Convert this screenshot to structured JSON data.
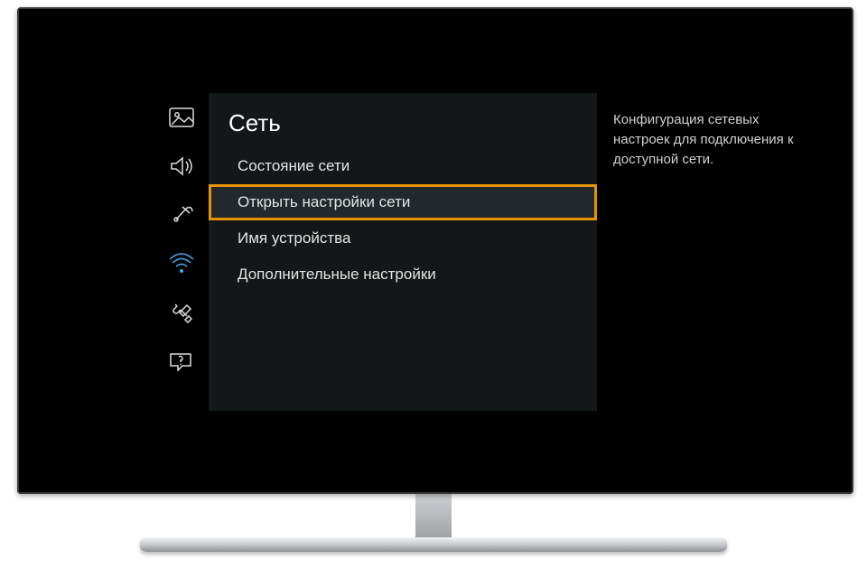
{
  "sidebar": {
    "items": [
      {
        "name": "picture",
        "active": false
      },
      {
        "name": "sound",
        "active": false
      },
      {
        "name": "broadcast",
        "active": false
      },
      {
        "name": "network",
        "active": true
      },
      {
        "name": "system",
        "active": false
      },
      {
        "name": "support",
        "active": false
      }
    ]
  },
  "panel": {
    "title": "Сеть",
    "menu": [
      {
        "label": "Состояние сети",
        "selected": false
      },
      {
        "label": "Открыть настройки сети",
        "selected": true
      },
      {
        "label": "Имя устройства",
        "selected": false
      },
      {
        "label": "Дополнительные настройки",
        "selected": false
      }
    ]
  },
  "help": {
    "text": "Конфигурация сетевых настроек для подключения к доступной сети."
  },
  "colors": {
    "highlight_border": "#e59400",
    "active_icon": "#3fa9f5"
  }
}
